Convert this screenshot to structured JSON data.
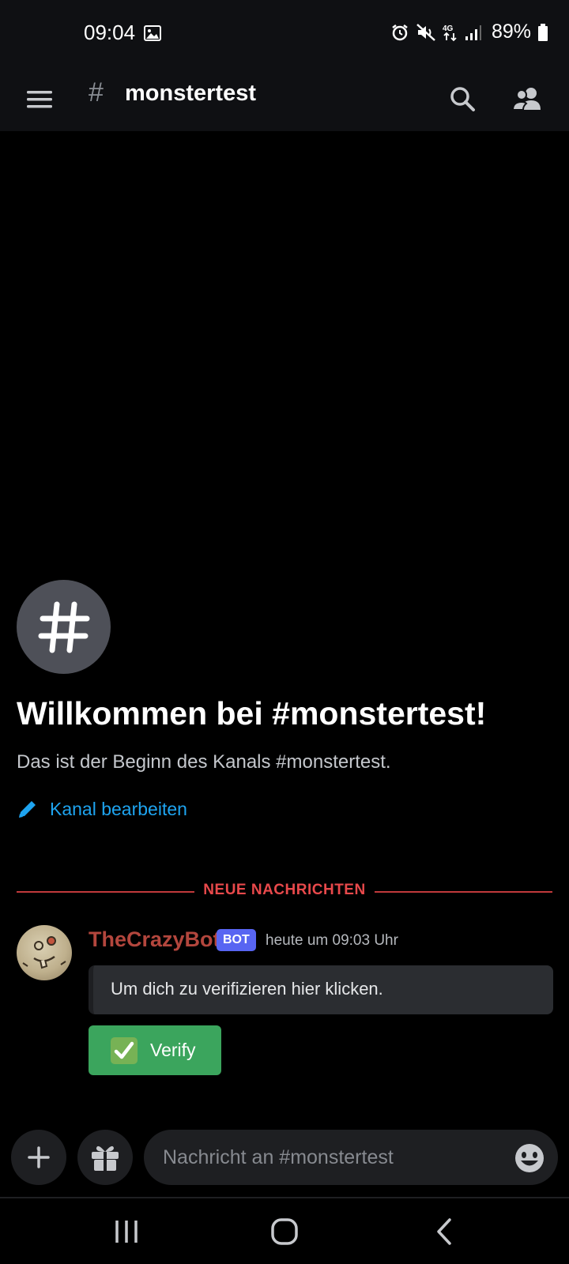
{
  "status_bar": {
    "time": "09:04",
    "battery": "89%",
    "network": "4G",
    "icons": [
      "image-icon",
      "alarm-icon",
      "mute-icon",
      "4g-icon",
      "signal-icon",
      "battery-icon"
    ]
  },
  "header": {
    "channel_name": "monstertest",
    "hash": "#",
    "icons": [
      "menu-icon",
      "search-icon",
      "members-icon"
    ]
  },
  "welcome": {
    "avatar_glyph": "#",
    "title": "Willkommen bei #monstertest!",
    "subtitle": "Das ist der Beginn des Kanals #monstertest.",
    "edit_label": "Kanal bearbeiten"
  },
  "divider": {
    "label": "NEUE NACHRICHTEN",
    "color": "#e8494b"
  },
  "message": {
    "author": "TheCrazyBot",
    "author_color": "#b3463d",
    "badge": "BOT",
    "timestamp": "heute um 09:03 Uhr",
    "embed_text": "Um dich zu verifizieren hier klicken.",
    "button_label": "Verify",
    "button_color": "#3ba55d"
  },
  "composer": {
    "placeholder": "Nachricht an #monstertest",
    "icons": [
      "plus-icon",
      "gift-icon",
      "emoji-icon"
    ]
  },
  "nav": {
    "icons": [
      "recents-icon",
      "home-icon",
      "back-icon"
    ]
  },
  "colors": {
    "background": "#000000",
    "bar": "#0f1013",
    "link": "#1ea4f0",
    "blurple": "#5865f2"
  }
}
